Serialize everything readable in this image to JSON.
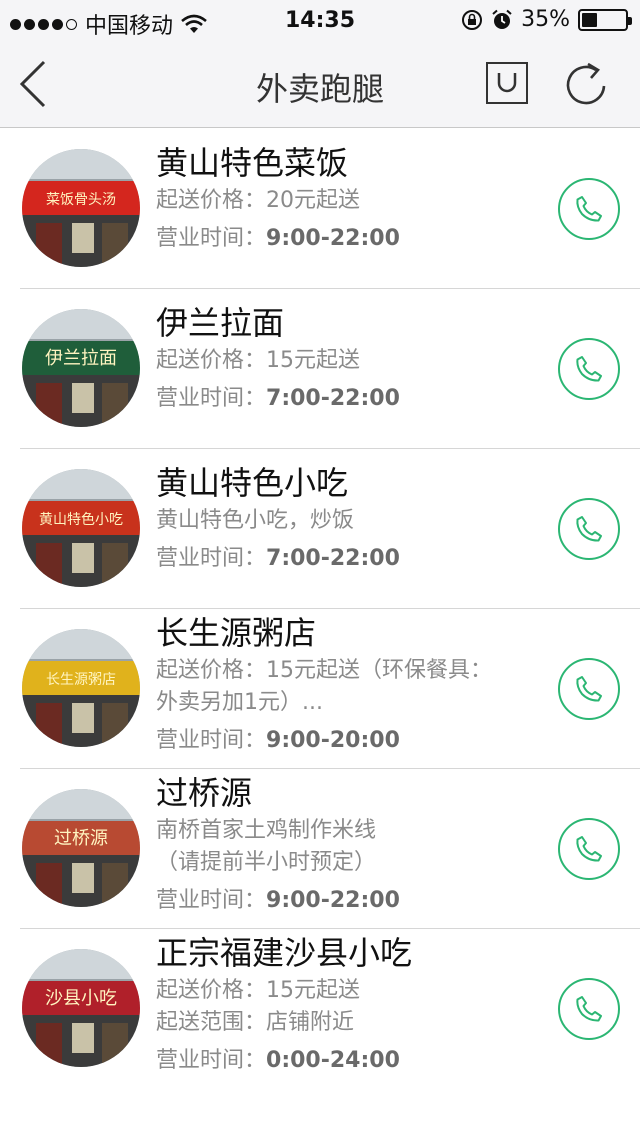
{
  "status_bar": {
    "carrier": "中国移动",
    "time": "14:35",
    "battery_text": "35%",
    "battery_level": 0.35,
    "icons": [
      "signal-dots-icon",
      "wifi-icon",
      "rotation-lock-icon",
      "alarm-icon",
      "battery-icon"
    ]
  },
  "nav": {
    "title": "外卖跑腿",
    "icons": [
      "back-icon",
      "shopping-bag-icon",
      "refresh-icon"
    ]
  },
  "shops": [
    {
      "name": "黄山特色菜饭",
      "lines": [
        "起送价格：20元起送"
      ],
      "hours_label": "营业时间：",
      "hours_value": "9:00-22:00",
      "avatar_sign": "菜饭骨头汤",
      "accent": "#d4261e"
    },
    {
      "name": "伊兰拉面",
      "lines": [
        "起送价格：15元起送"
      ],
      "hours_label": "营业时间：",
      "hours_value": "7:00-22:00",
      "avatar_sign": "伊兰拉面",
      "accent": "#1f5e3a"
    },
    {
      "name": "黄山特色小吃",
      "lines": [
        "黄山特色小吃，炒饭"
      ],
      "hours_label": "营业时间：",
      "hours_value": "7:00-22:00",
      "avatar_sign": "黄山特色小吃",
      "accent": "#c8321c"
    },
    {
      "name": "长生源粥店",
      "lines": [
        "起送价格：15元起送（环保餐具：",
        "外卖另加1元）..."
      ],
      "hours_label": "营业时间：",
      "hours_value": "9:00-20:00",
      "avatar_sign": "长生源粥店",
      "accent": "#e0b21c"
    },
    {
      "name": "过桥源",
      "lines": [
        "南桥首家土鸡制作米线",
        "（请提前半小时预定）"
      ],
      "hours_label": "营业时间：",
      "hours_value": "9:00-22:00",
      "avatar_sign": "过桥源",
      "accent": "#b84a32"
    },
    {
      "name": "正宗福建沙县小吃",
      "lines": [
        "起送价格：15元起送",
        "起送范围：店铺附近"
      ],
      "hours_label": "营业时间：",
      "hours_value": "0:00-24:00",
      "avatar_sign": "沙县小吃",
      "accent": "#b0202a"
    }
  ],
  "colors": {
    "phone_accent": "#2bb673",
    "nav_background": "#f5f5f7",
    "secondary_text": "#8a8a8a"
  }
}
